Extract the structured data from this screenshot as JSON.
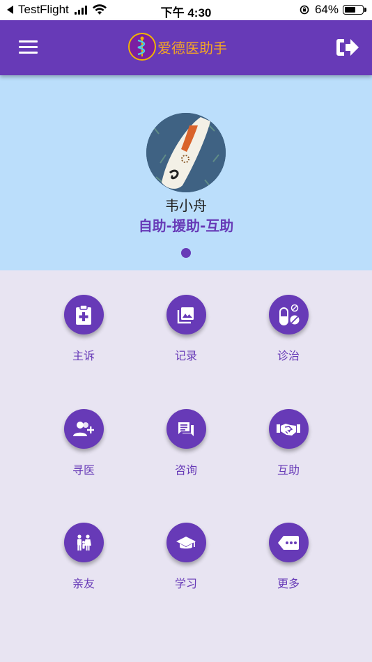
{
  "status_bar": {
    "back_app": "TestFlight",
    "time": "下午 4:30",
    "battery": "64%",
    "battery_level": 0.64
  },
  "app_bar": {
    "title": "爱德医助手"
  },
  "profile": {
    "name": "韦小舟",
    "motto": "自助-援助-互助",
    "page_index": 1,
    "page_count": 1
  },
  "menu": {
    "items": [
      {
        "label": "主诉",
        "icon": "clipboard-plus-icon"
      },
      {
        "label": "记录",
        "icon": "photo-library-icon"
      },
      {
        "label": "诊治",
        "icon": "pills-icon"
      },
      {
        "label": "寻医",
        "icon": "person-add-icon"
      },
      {
        "label": "咨询",
        "icon": "chat-icon"
      },
      {
        "label": "互助",
        "icon": "handshake-icon"
      },
      {
        "label": "亲友",
        "icon": "family-icon"
      },
      {
        "label": "学习",
        "icon": "graduation-cap-icon"
      },
      {
        "label": "更多",
        "icon": "more-tag-icon"
      }
    ]
  },
  "colors": {
    "primary": "#673ab7",
    "profile_bg": "#bbdefb",
    "page_bg": "#e8e4f2",
    "brand_title": "#f5a623"
  }
}
